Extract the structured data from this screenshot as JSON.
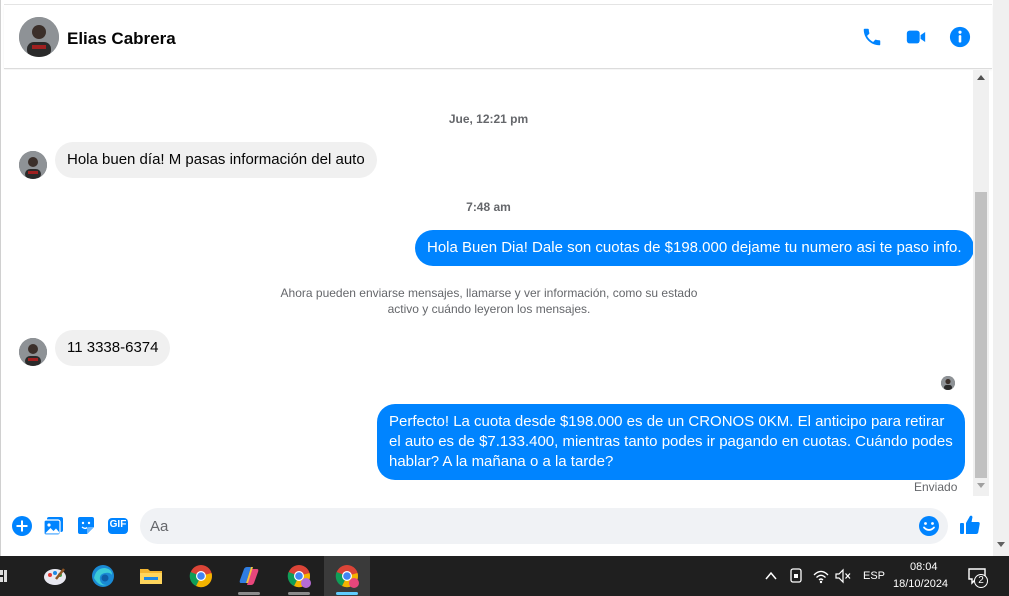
{
  "header": {
    "contact_name": "Elias Cabrera"
  },
  "chat": {
    "timestamps": [
      "Jue, 12:21 pm",
      "7:48 am"
    ],
    "system_notice_line1": "Ahora pueden enviarse mensajes, llamarse y ver información, como su estado",
    "system_notice_line2": "activo y cuándo leyeron los mensajes.",
    "messages": [
      {
        "direction": "in",
        "text": "Hola buen día! M pasas información del auto"
      },
      {
        "direction": "out",
        "text": "Hola Buen Dia! Dale son cuotas de $198.000 dejame tu numero asi te paso info."
      },
      {
        "direction": "in",
        "text": "11 3338-6374"
      },
      {
        "direction": "out",
        "text": "Perfecto! La cuota desde $198.000 es de un CRONOS 0KM. El anticipo para retirar el auto es de $7.133.400, mientras tanto podes ir pagando en cuotas. Cuándo podes hablar? A la mañana o a la tarde?"
      }
    ],
    "status": "Enviado"
  },
  "composer": {
    "placeholder": "Aa",
    "gif_label": "GIF"
  },
  "taskbar": {
    "apps": [
      "paint-icon",
      "edge-icon",
      "file-explorer-icon",
      "chrome-icon",
      "copilot-icon",
      "chrome-profile-icon",
      "chrome-active-icon"
    ],
    "language": "ESP",
    "time": "08:04",
    "date": "18/10/2024",
    "notification_count": "2"
  },
  "colors": {
    "accent": "#0084ff",
    "incoming_bubble": "#f0f0f0",
    "taskbar": "#1f1f1f"
  }
}
